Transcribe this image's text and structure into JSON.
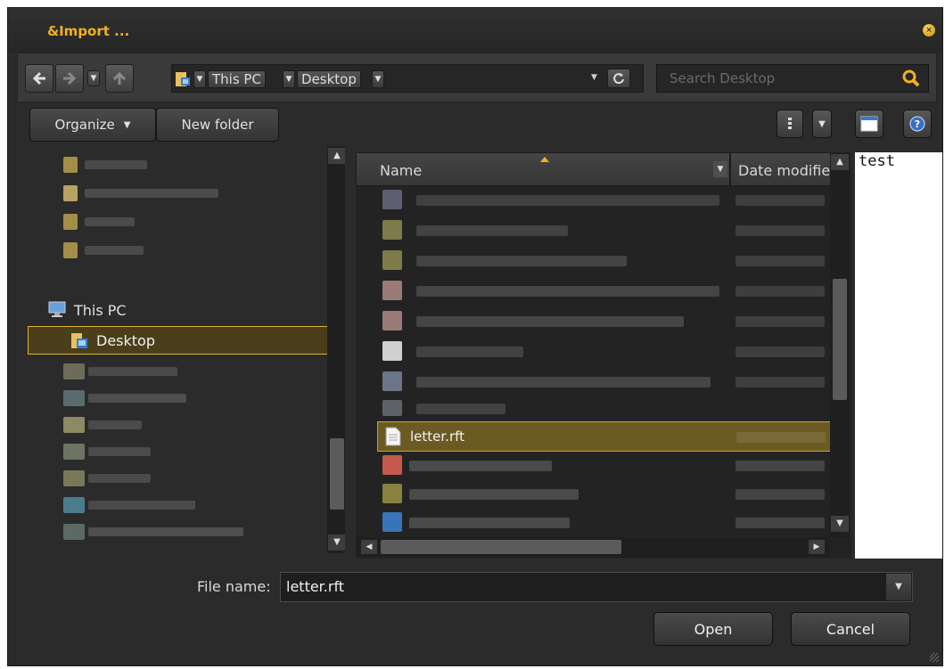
{
  "window": {
    "title": "&Import ...",
    "close_icon": "close-icon"
  },
  "nav": {
    "breadcrumbs": [
      "This PC",
      "Desktop"
    ],
    "search_placeholder": "Search Desktop"
  },
  "toolbar": {
    "organize_label": "Organize",
    "new_folder_label": "New folder"
  },
  "sidebar": {
    "this_pc_label": "This PC",
    "selected_label": "Desktop"
  },
  "file_list": {
    "columns": [
      "Name",
      "Date modifie"
    ],
    "selected_file": "letter.rft"
  },
  "preview": {
    "text": "test"
  },
  "footer": {
    "file_name_label": "File name:",
    "file_name_value": "letter.rft",
    "open_label": "Open",
    "cancel_label": "Cancel"
  },
  "colors": {
    "accent": "#e0b030",
    "title": "#f0b020",
    "background": "#2b2b2b"
  }
}
